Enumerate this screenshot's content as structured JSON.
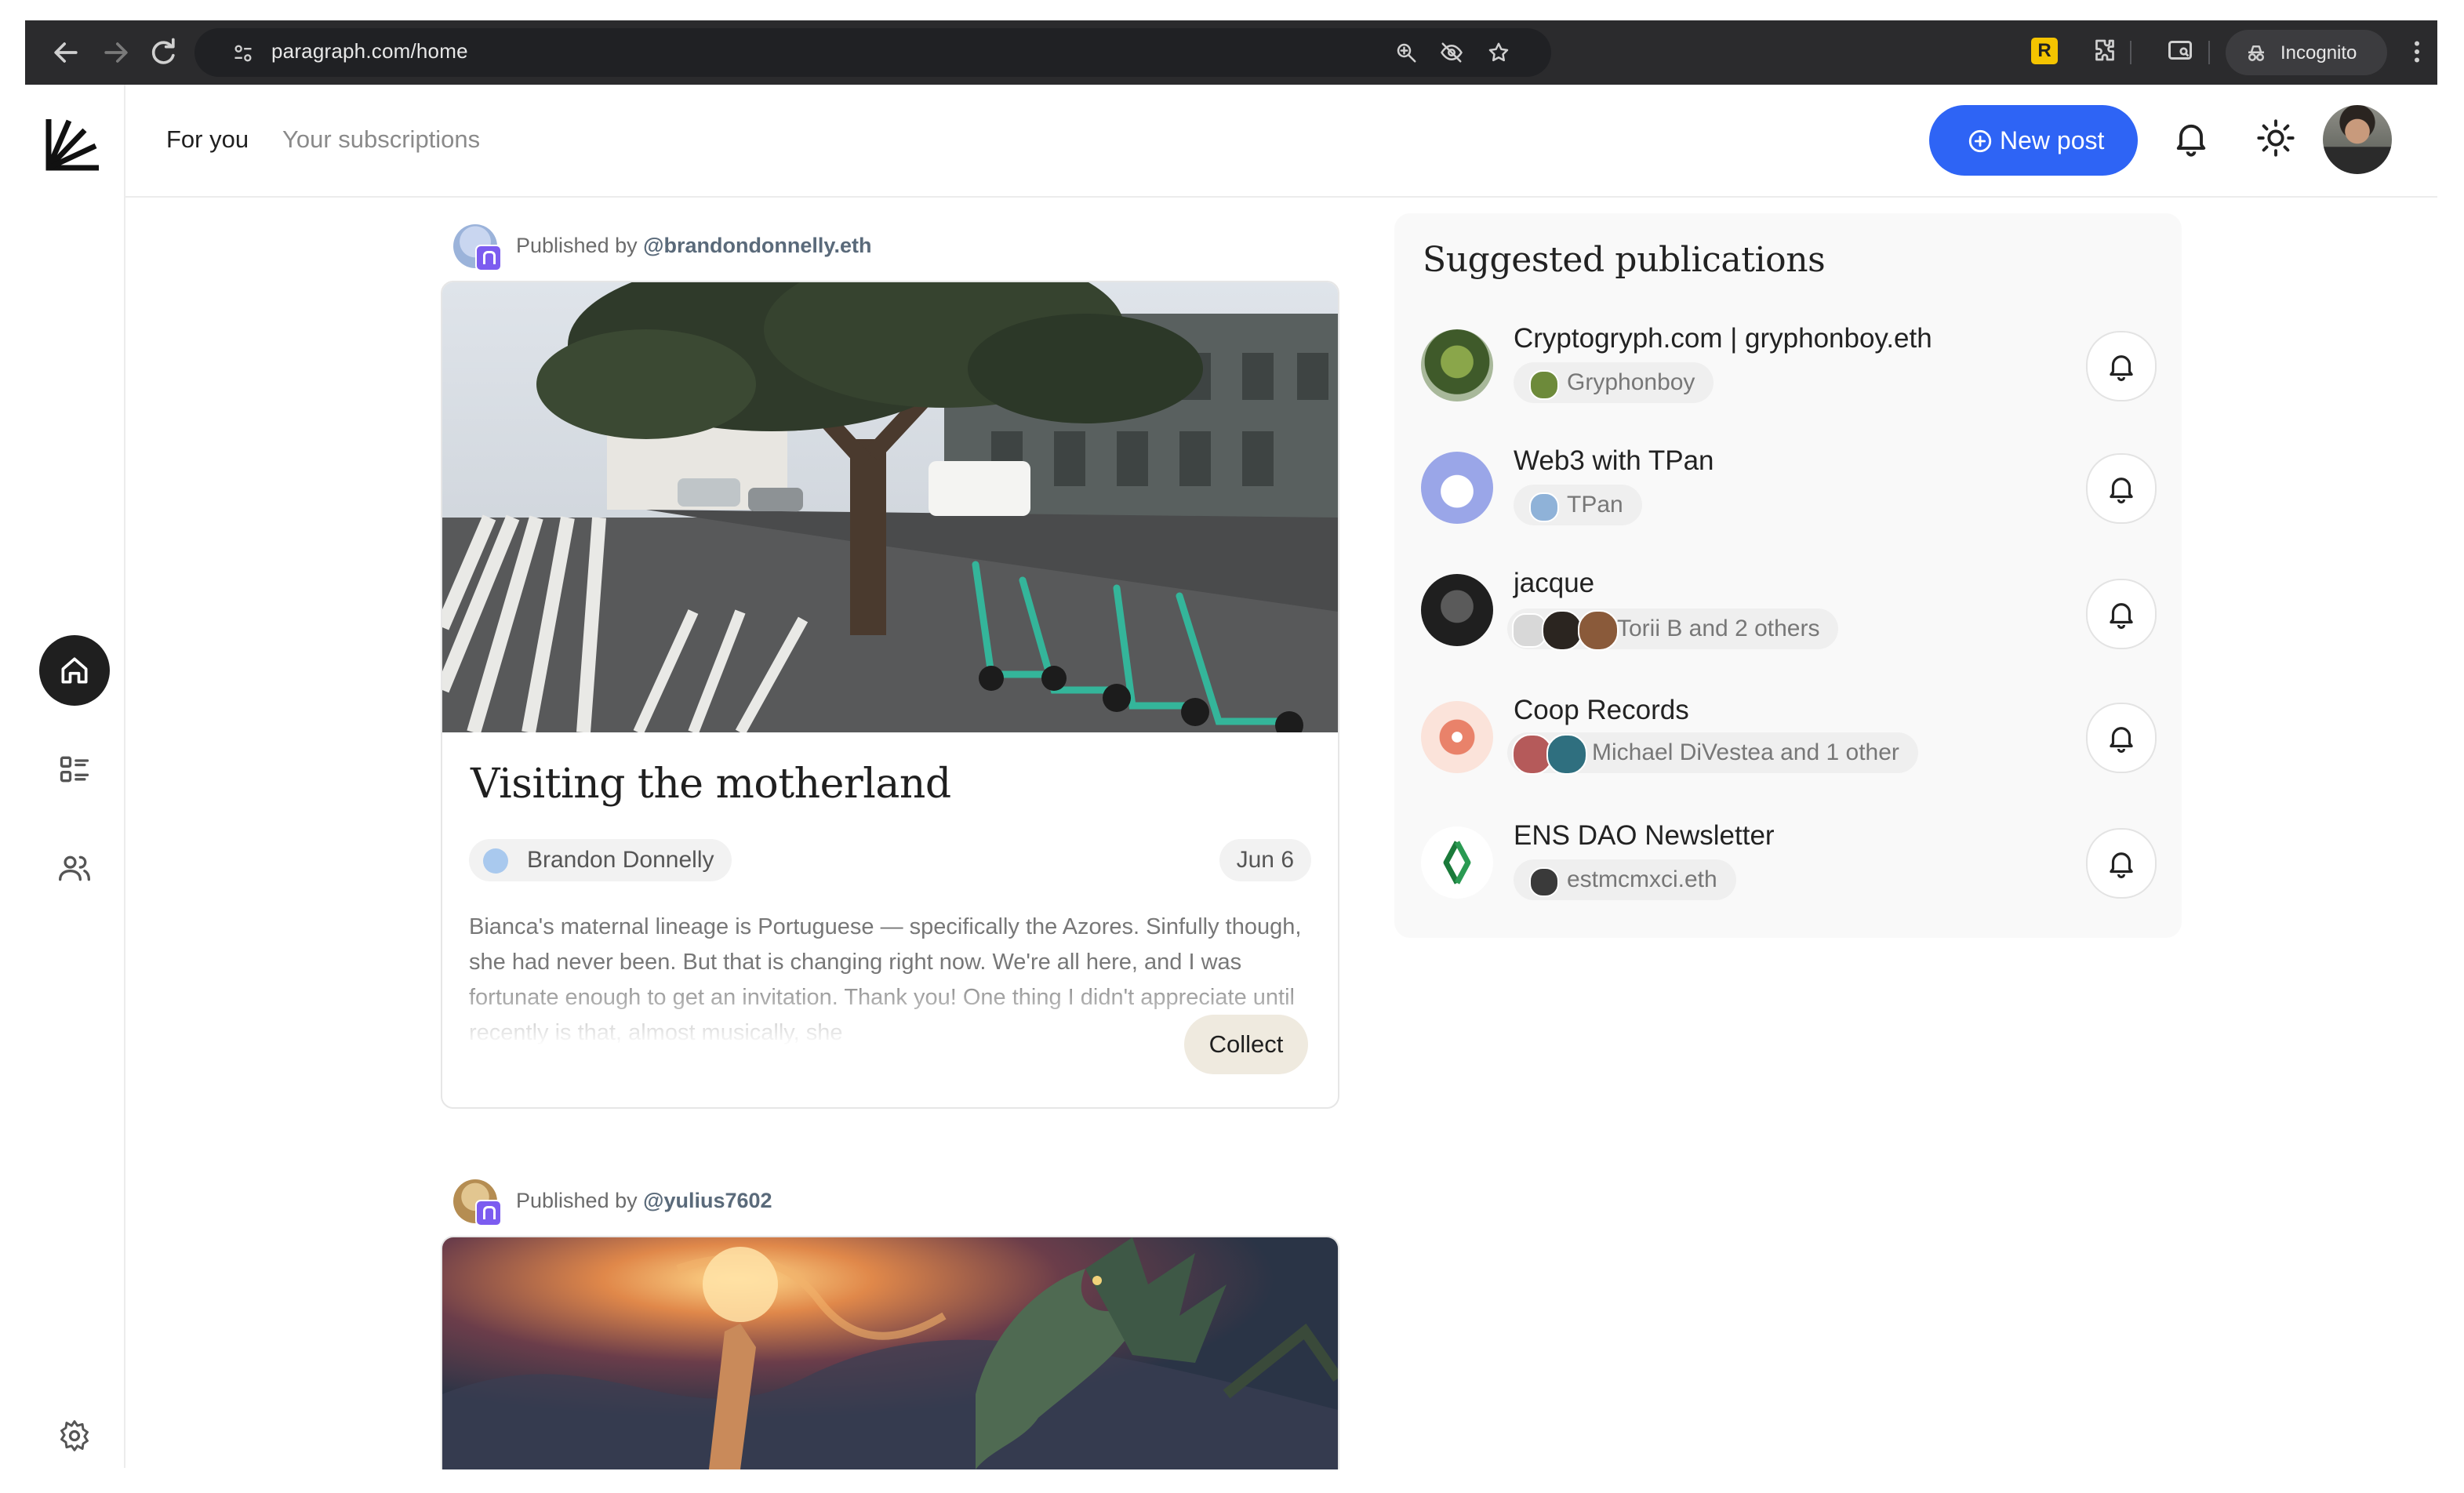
{
  "browser": {
    "url": "paragraph.com/home",
    "incognito_label": "Incognito",
    "icons": [
      "back-icon",
      "forward-icon",
      "reload-icon",
      "site-settings-icon",
      "zoom-icon",
      "eye-off-icon",
      "star-icon",
      "extension-r-icon",
      "puzzle-icon",
      "tab-search-icon",
      "incognito-icon",
      "more-icon"
    ],
    "extension_letter": "R"
  },
  "nav": {
    "tabs": [
      {
        "label": "For you",
        "active": true
      },
      {
        "label": "Your subscriptions",
        "active": false
      }
    ],
    "new_post_label": "New post",
    "accent": "#2e64f5"
  },
  "sidebar": {
    "items": [
      "home-icon",
      "feed-list-icon",
      "people-icon"
    ],
    "bottom": "settings-icon"
  },
  "feed": {
    "posts": [
      {
        "published_prefix": "Published by",
        "publisher": "@brandondonnelly.eth",
        "title": "Visiting the motherland",
        "author": "Brandon Donnelly",
        "date": "Jun 6",
        "excerpt": "Bianca's maternal lineage is Portuguese — specifically the Azores. Sinfully though, she had never been. But that is changing right now. We're all here, and I was fortunate enough to get an invitation. Thank you! One thing I didn't appreciate until recently is that, almost musically, she",
        "collect_label": "Collect"
      },
      {
        "published_prefix": "Published by",
        "publisher": "@yulius7602"
      }
    ]
  },
  "suggested": {
    "heading": "Suggested publications",
    "items": [
      {
        "name": "Cryptogryph.com | gryphonboy.eth",
        "authors": "Gryphonboy"
      },
      {
        "name": "Web3 with TPan",
        "authors": "TPan"
      },
      {
        "name": "jacque",
        "authors": "Torii B and 2 others"
      },
      {
        "name": "Coop Records",
        "authors": "Michael DiVestea and 1 other"
      },
      {
        "name": "ENS DAO Newsletter",
        "authors": "estmcmxci.eth"
      }
    ]
  }
}
